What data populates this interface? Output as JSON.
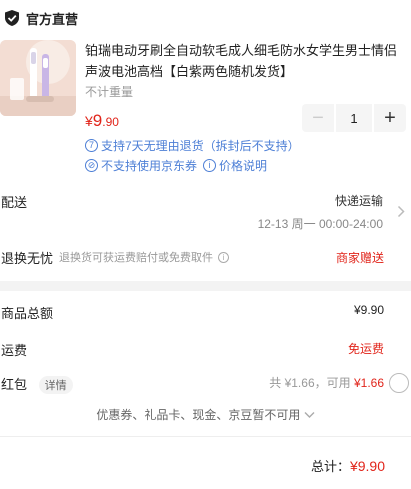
{
  "store": {
    "name": "官方直营",
    "icon": "shield-check-icon"
  },
  "product": {
    "title": "铂瑞电动牙刷全自动软毛成人细毛防水女学生男士情侣声波电池高档【白紫两色随机发货】",
    "weight": "不计重量",
    "price_symbol": "¥",
    "price_int": "9",
    "price_dec": ".90",
    "quantity": "1",
    "minus": "−",
    "plus": "+",
    "service_return_num": "7",
    "service_return": "支持7天无理由退货（拆封后不支持）",
    "service_coupon_icon": "⊘",
    "service_coupon": "不支持使用京东券",
    "service_price_icon": "i",
    "service_price": "价格说明"
  },
  "shipping": {
    "label": "配送",
    "method": "快递运输",
    "time": "12-13 周一 00:00-24:00"
  },
  "returns": {
    "label": "退换无忧",
    "desc": "退换货可获运费赔付或免费取件",
    "info_icon": "i",
    "tag": "商家赠送"
  },
  "summary": {
    "goods_label": "商品总额",
    "goods_value": "¥9.90",
    "freight_label": "运费",
    "freight_value": "免运费",
    "hongbao_label": "红包",
    "hongbao_detail": "详情",
    "hongbao_total": "共 ¥1.66，可用",
    "hongbao_available": "¥1.66",
    "coupon_note": "优惠券、礼品卡、现金、京豆暂不可用"
  },
  "total": {
    "label": "总计：",
    "value": "¥9.90"
  },
  "colors": {
    "accent": "#e1251b",
    "link": "#4d7fd6"
  }
}
